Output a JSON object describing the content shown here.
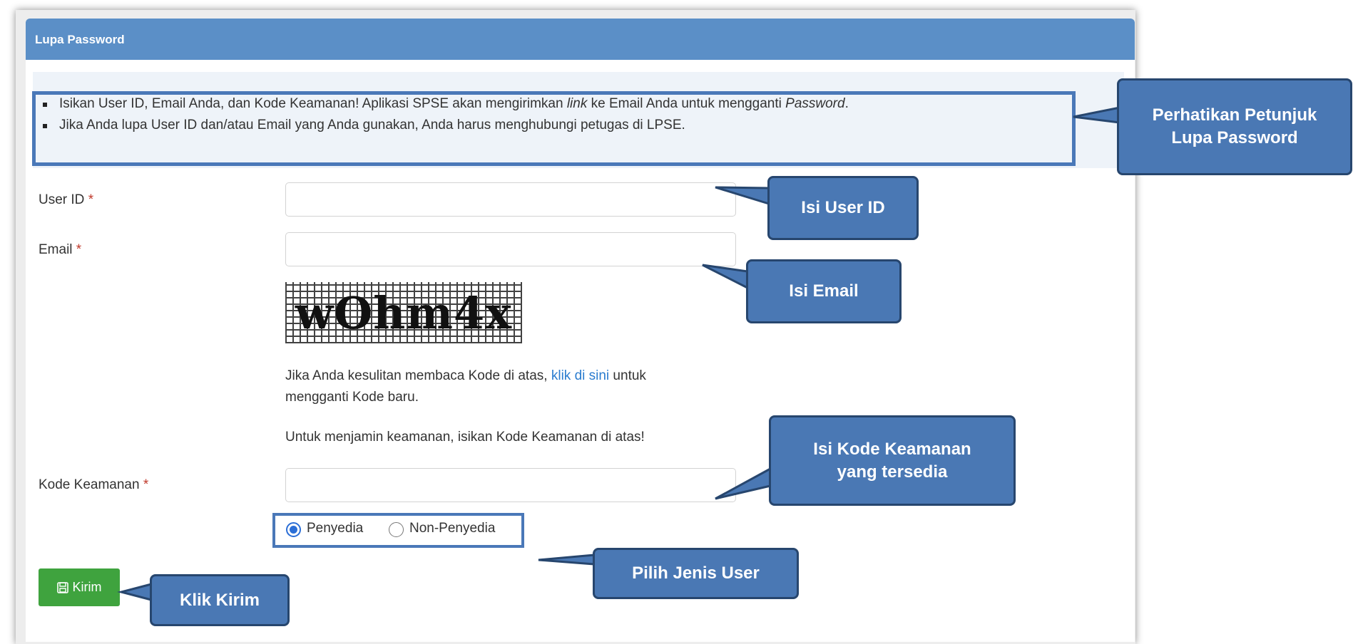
{
  "panel": {
    "title": "Lupa Password"
  },
  "info": {
    "line1_a": "Isikan User ID, Email Anda, dan Kode Keamanan! Aplikasi SPSE akan mengirimkan ",
    "line1_link": "link",
    "line1_b": " ke Email Anda untuk mengganti ",
    "line1_pw": "Password",
    "line1_c": ".",
    "line2": "Jika Anda lupa User ID dan/atau Email yang Anda gunakan, Anda harus menghubungi petugas di LPSE."
  },
  "form": {
    "user_id_label": "User ID",
    "email_label": "Email",
    "kode_label": "Kode Keamanan",
    "required_mark": "*",
    "user_id_value": "",
    "email_value": "",
    "kode_value": "",
    "captcha_text": "wOhm4x",
    "captcha_help_a": "Jika Anda kesulitan membaca Kode di atas, ",
    "captcha_help_link": "klik di sini",
    "captcha_help_b": " untuk",
    "captcha_help_c": "mengganti Kode baru.",
    "security_note": "Untuk menjamin keamanan, isikan Kode Keamanan di atas!",
    "radio_penyedia": "Penyedia",
    "radio_non_penyedia": "Non-Penyedia",
    "selected_user_type": "Penyedia",
    "submit_label": "Kirim"
  },
  "callouts": {
    "petunjuk_line1": "Perhatikan Petunjuk",
    "petunjuk_line2": "Lupa Password",
    "user_id": "Isi User ID",
    "email": "Isi Email",
    "kode_line1": "Isi Kode Keamanan",
    "kode_line2": "yang tersedia",
    "jenis_user": "Pilih Jenis User",
    "kirim": "Klik Kirim"
  },
  "colors": {
    "header": "#5b8fc7",
    "callout": "#4a78b4",
    "submit": "#3fa33e",
    "link": "#2a7ccf",
    "required": "#c0392b"
  }
}
